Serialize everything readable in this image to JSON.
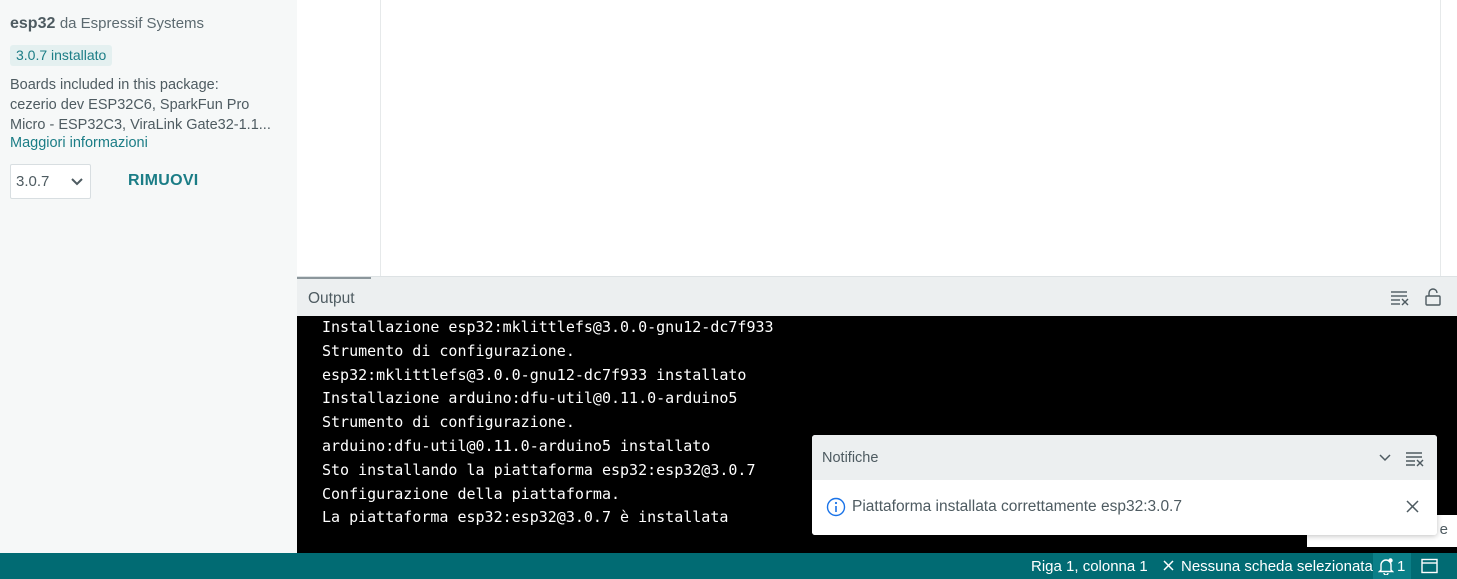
{
  "sidebar": {
    "package_name": "esp32",
    "package_author": "da Espressif Systems",
    "installed_badge": "3.0.7 installato",
    "description_lines": [
      "Boards included in this package:",
      "cezerio dev ESP32C6, SparkFun Pro",
      "Micro - ESP32C3, ViraLink Gate32-1.1..."
    ],
    "more_info_link": "Maggiori informazioni",
    "version_selected": "3.0.7",
    "remove_button": "RIMUOVI"
  },
  "output_panel": {
    "tab_label": "Output",
    "lines": [
      "Installazione esp32:mklittlefs@3.0.0-gnu12-dc7f933",
      "Strumento di configurazione.",
      "esp32:mklittlefs@3.0.0-gnu12-dc7f933 installato",
      "Installazione arduino:dfu-util@0.11.0-arduino5",
      "Strumento di configurazione.",
      "arduino:dfu-util@0.11.0-arduino5 installato",
      "Sto installando la piattaforma esp32:esp32@3.0.7",
      "Configurazione della piattaforma.",
      "La piattaforma esp32:esp32@3.0.7 è installata"
    ]
  },
  "notification": {
    "title": "Notifiche",
    "message": "Piattaforma installata correttamente esp32:3.0.7",
    "tooltip_fragment": "e"
  },
  "statusbar": {
    "cursor_position": "Riga 1, colonna 1",
    "board_status": "Nessuna scheda selezionata",
    "notification_count": "1"
  },
  "colors": {
    "accent": "#1b7d86",
    "statusbar_bg": "#016b73",
    "console_bg": "#000000",
    "info_icon": "#1a73e8"
  },
  "icons": {
    "chevron": "chevron-down-icon",
    "clear_output": "clear-output-icon",
    "lock": "unlock-icon",
    "info": "info-icon",
    "close": "close-icon",
    "bell": "bell-icon",
    "panel": "toggle-panel-icon"
  }
}
